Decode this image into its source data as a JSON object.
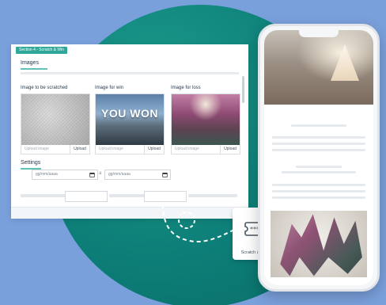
{
  "editor": {
    "section_tab": "Section 4 - Scratch & Win",
    "images": {
      "title": "Images",
      "columns": [
        {
          "label": "Image to be scratched",
          "upload_placeholder": "Upload image",
          "upload_button": "Upload"
        },
        {
          "label": "Image for win",
          "image_text": "YOU WON",
          "upload_placeholder": "Upload image",
          "upload_button": "Upload"
        },
        {
          "label": "Image for loss",
          "upload_placeholder": "Upload image",
          "upload_button": "Upload"
        }
      ]
    },
    "settings": {
      "title": "Settings",
      "start_date_placeholder": "gg/mm/aaaa",
      "range_separator": "a",
      "end_date_placeholder": "gg/mm/aaaa"
    }
  },
  "widget": {
    "label": "Scratch & Win",
    "icon": "scratch-card-icon"
  },
  "colors": {
    "background": "#7aa0dc",
    "teal": "#0d7f78",
    "accent": "#2fa89a"
  }
}
